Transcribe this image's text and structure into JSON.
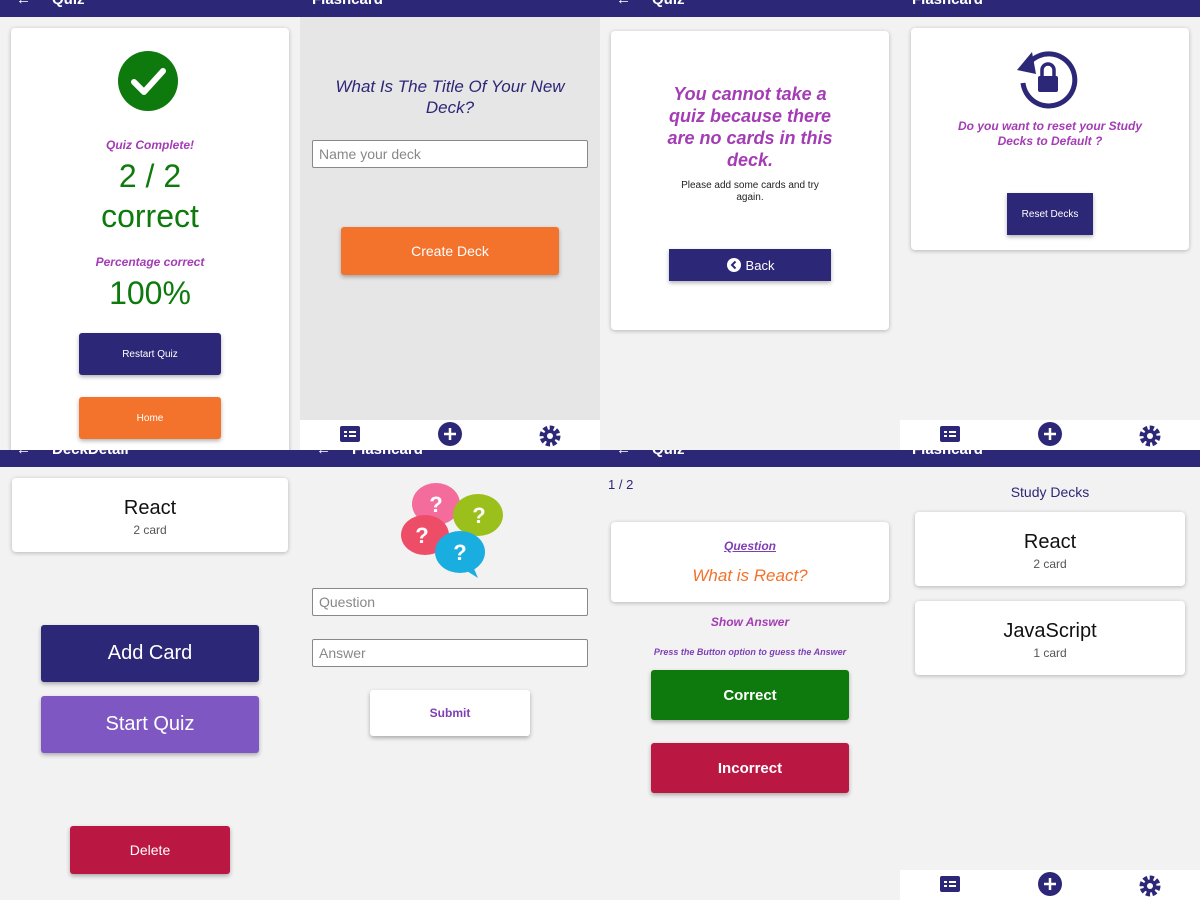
{
  "colors": {
    "primary": "#2d2777",
    "orange": "#f3722c",
    "green": "#0e7a0d",
    "magenta": "#a43cb5",
    "purple": "#7e57c2",
    "crimson": "#bb1743"
  },
  "quiz_result": {
    "header_title": "Quiz",
    "complete_label": "Quiz Complete!",
    "score": "2 / 2",
    "correct_label": "correct",
    "percentage_label": "Percentage correct",
    "percentage": "100%",
    "restart_label": "Restart Quiz",
    "home_label": "Home"
  },
  "new_deck": {
    "header_title": "Flashcard",
    "question": "What Is The Title Of Your New Deck?",
    "input_placeholder": "Name your deck",
    "create_label": "Create Deck"
  },
  "no_cards": {
    "header_title": "Quiz",
    "message": "You cannot take a quiz because there are no cards in this deck.",
    "hint": "Please add some cards and try again.",
    "back_label": "Back"
  },
  "settings": {
    "header_title": "Flashcard",
    "question": "Do you want to reset your Study Decks to Default ?",
    "reset_label": "Reset Decks"
  },
  "deck_detail": {
    "header_title": "DeckDetail",
    "deck_title": "React",
    "deck_count": "2 card",
    "add_card_label": "Add Card",
    "start_quiz_label": "Start Quiz",
    "delete_label": "Delete"
  },
  "add_card": {
    "header_title": "Flashcard",
    "question_placeholder": "Question",
    "answer_placeholder": "Answer",
    "submit_label": "Submit"
  },
  "quiz": {
    "header_title": "Quiz",
    "progress": "1 / 2",
    "question_link": "Question",
    "question_text": "What is React?",
    "show_answer": "Show Answer",
    "hint": "Press the Button option to guess the Answer",
    "correct_label": "Correct",
    "incorrect_label": "Incorrect"
  },
  "deck_list": {
    "header_title": "Flashcard",
    "heading": "Study Decks",
    "decks": [
      {
        "title": "React",
        "count": "2 card"
      },
      {
        "title": "JavaScript",
        "count": "1 card"
      }
    ]
  },
  "tabbar": {
    "decks_label": "Decks",
    "add_deck_label": "Add Deck",
    "settings_label": "Settings"
  }
}
